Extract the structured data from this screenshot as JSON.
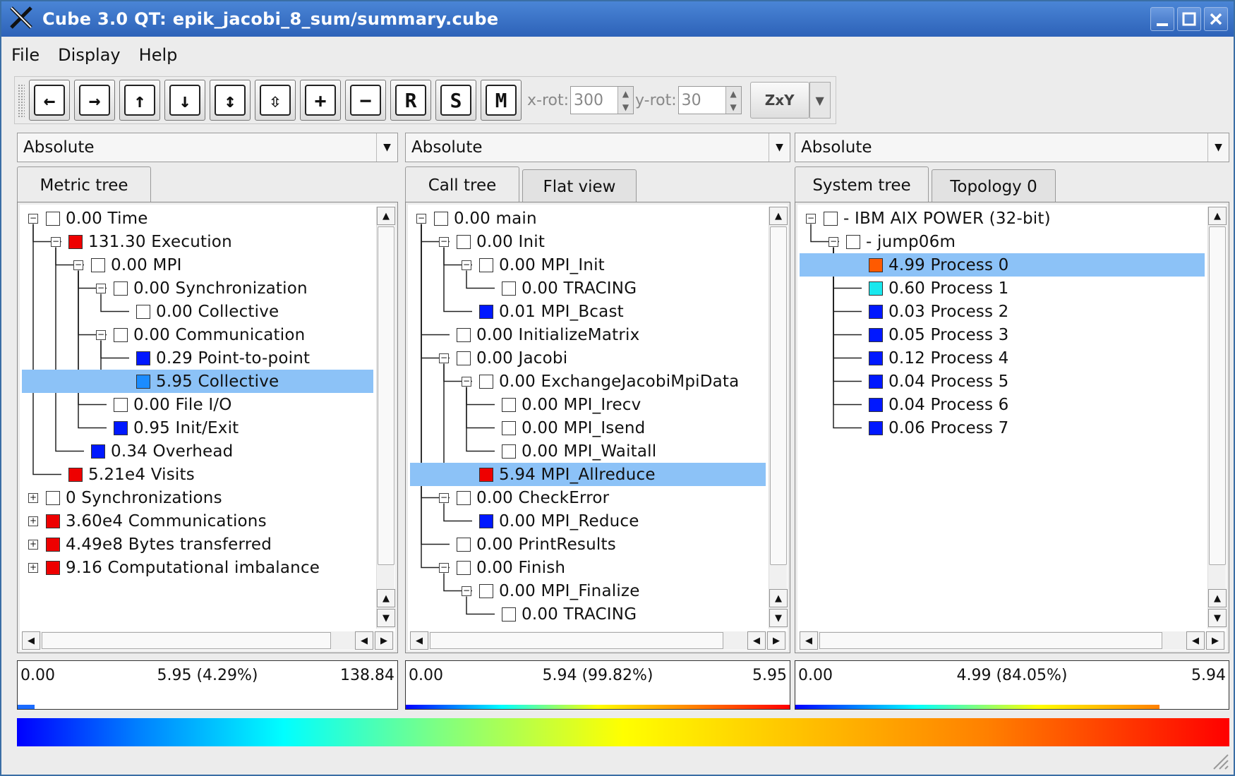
{
  "window": {
    "title": "Cube 3.0 QT: epik_jacobi_8_sum/summary.cube"
  },
  "menu": [
    "File",
    "Display",
    "Help"
  ],
  "toolbar": {
    "buttons": [
      {
        "name": "back-button",
        "glyph": "←"
      },
      {
        "name": "forward-button",
        "glyph": "→"
      },
      {
        "name": "move-up-button",
        "glyph": "↑"
      },
      {
        "name": "move-down-button",
        "glyph": "↓"
      },
      {
        "name": "expand-button",
        "glyph": "↕"
      },
      {
        "name": "collapse-button",
        "glyph": "⇳"
      },
      {
        "name": "zoom-in-button",
        "glyph": "+"
      },
      {
        "name": "zoom-out-button",
        "glyph": "−"
      },
      {
        "name": "reset-button",
        "glyph": "R"
      },
      {
        "name": "s-button",
        "glyph": "S"
      },
      {
        "name": "m-button",
        "glyph": "M"
      }
    ],
    "xrot_label": "x-rot:",
    "xrot_value": "300",
    "yrot_label": "y-rot:",
    "yrot_value": "30",
    "axis_label": "ZxY"
  },
  "panels": {
    "metric": {
      "mode": "Absolute",
      "tabs": [
        "Metric tree"
      ],
      "items": [
        {
          "depth": 0,
          "exp": "-",
          "color": "#ffffff",
          "label": "0.00 Time"
        },
        {
          "depth": 1,
          "exp": "-",
          "color": "#ee0000",
          "label": "131.30 Execution"
        },
        {
          "depth": 2,
          "exp": "-",
          "color": "#ffffff",
          "label": "0.00 MPI"
        },
        {
          "depth": 3,
          "exp": "-",
          "color": "#ffffff",
          "label": "0.00 Synchronization"
        },
        {
          "depth": 4,
          "exp": "",
          "color": "#ffffff",
          "label": "0.00 Collective"
        },
        {
          "depth": 3,
          "exp": "-",
          "color": "#ffffff",
          "label": "0.00 Communication"
        },
        {
          "depth": 4,
          "exp": "",
          "color": "#0018ff",
          "label": "0.29 Point-to-point"
        },
        {
          "depth": 4,
          "exp": "",
          "color": "#1b8cff",
          "label": "5.95 Collective",
          "selected": true
        },
        {
          "depth": 3,
          "exp": "",
          "color": "#ffffff",
          "label": "0.00 File I/O"
        },
        {
          "depth": 3,
          "exp": "",
          "color": "#0018ff",
          "label": "0.95 Init/Exit"
        },
        {
          "depth": 2,
          "exp": "",
          "color": "#0018ff",
          "label": "0.34 Overhead"
        },
        {
          "depth": 1,
          "exp": "",
          "color": "#ee0000",
          "label": "5.21e4 Visits"
        },
        {
          "depth": 0,
          "exp": "+",
          "color": "#ffffff",
          "label": "0 Synchronizations"
        },
        {
          "depth": 0,
          "exp": "+",
          "color": "#ee0000",
          "label": "3.60e4 Communications"
        },
        {
          "depth": 0,
          "exp": "+",
          "color": "#ee0000",
          "label": "4.49e8 Bytes transferred"
        },
        {
          "depth": 0,
          "exp": "+",
          "color": "#ee0000",
          "label": "9.16 Computational imbalance"
        }
      ],
      "value_min": "0.00",
      "value_sel": "5.95 (4.29%)",
      "value_max": "138.84"
    },
    "call": {
      "mode": "Absolute",
      "tabs": [
        "Call tree",
        "Flat view"
      ],
      "items": [
        {
          "depth": 0,
          "exp": "-",
          "color": "#ffffff",
          "label": "0.00 main"
        },
        {
          "depth": 1,
          "exp": "-",
          "color": "#ffffff",
          "label": "0.00 Init"
        },
        {
          "depth": 2,
          "exp": "-",
          "color": "#ffffff",
          "label": "0.00 MPI_Init"
        },
        {
          "depth": 3,
          "exp": "",
          "color": "#ffffff",
          "label": "0.00 TRACING"
        },
        {
          "depth": 2,
          "exp": "",
          "color": "#0018ff",
          "label": "0.01 MPI_Bcast"
        },
        {
          "depth": 1,
          "exp": "",
          "color": "#ffffff",
          "label": "0.00 InitializeMatrix"
        },
        {
          "depth": 1,
          "exp": "-",
          "color": "#ffffff",
          "label": "0.00 Jacobi"
        },
        {
          "depth": 2,
          "exp": "-",
          "color": "#ffffff",
          "label": "0.00 ExchangeJacobiMpiData"
        },
        {
          "depth": 3,
          "exp": "",
          "color": "#ffffff",
          "label": "0.00 MPI_Irecv"
        },
        {
          "depth": 3,
          "exp": "",
          "color": "#ffffff",
          "label": "0.00 MPI_Isend"
        },
        {
          "depth": 3,
          "exp": "",
          "color": "#ffffff",
          "label": "0.00 MPI_Waitall"
        },
        {
          "depth": 2,
          "exp": "",
          "color": "#ee0000",
          "label": "5.94 MPI_Allreduce",
          "selected": true
        },
        {
          "depth": 1,
          "exp": "-",
          "color": "#ffffff",
          "label": "0.00 CheckError"
        },
        {
          "depth": 2,
          "exp": "",
          "color": "#0018ff",
          "label": "0.00 MPI_Reduce"
        },
        {
          "depth": 1,
          "exp": "",
          "color": "#ffffff",
          "label": "0.00 PrintResults"
        },
        {
          "depth": 1,
          "exp": "-",
          "color": "#ffffff",
          "label": "0.00 Finish"
        },
        {
          "depth": 2,
          "exp": "-",
          "color": "#ffffff",
          "label": "0.00 MPI_Finalize"
        },
        {
          "depth": 3,
          "exp": "",
          "color": "#ffffff",
          "label": "0.00 TRACING"
        }
      ],
      "value_min": "0.00",
      "value_sel": "5.94 (99.82%)",
      "value_max": "5.95"
    },
    "system": {
      "mode": "Absolute",
      "tabs": [
        "System tree",
        "Topology 0"
      ],
      "items": [
        {
          "depth": 0,
          "exp": "-",
          "color": "#ffffff",
          "label": "- IBM AIX POWER (32-bit)"
        },
        {
          "depth": 1,
          "exp": "-",
          "color": "#ffffff",
          "label": "- jump06m"
        },
        {
          "depth": 2,
          "exp": "",
          "color": "#ff5a00",
          "label": "4.99 Process 0",
          "selected": true
        },
        {
          "depth": 2,
          "exp": "",
          "color": "#19e8ee",
          "label": "0.60 Process 1"
        },
        {
          "depth": 2,
          "exp": "",
          "color": "#0018ff",
          "label": "0.03 Process 2"
        },
        {
          "depth": 2,
          "exp": "",
          "color": "#0018ff",
          "label": "0.05 Process 3"
        },
        {
          "depth": 2,
          "exp": "",
          "color": "#0018ff",
          "label": "0.12 Process 4"
        },
        {
          "depth": 2,
          "exp": "",
          "color": "#0018ff",
          "label": "0.04 Process 5"
        },
        {
          "depth": 2,
          "exp": "",
          "color": "#0018ff",
          "label": "0.04 Process 6"
        },
        {
          "depth": 2,
          "exp": "",
          "color": "#0018ff",
          "label": "0.06 Process 7"
        }
      ],
      "value_min": "0.00",
      "value_sel": "4.99 (84.05%)",
      "value_max": "5.94"
    }
  },
  "colors": {
    "selection": "#8cc2f7",
    "titlebar": "#2d62b8"
  }
}
